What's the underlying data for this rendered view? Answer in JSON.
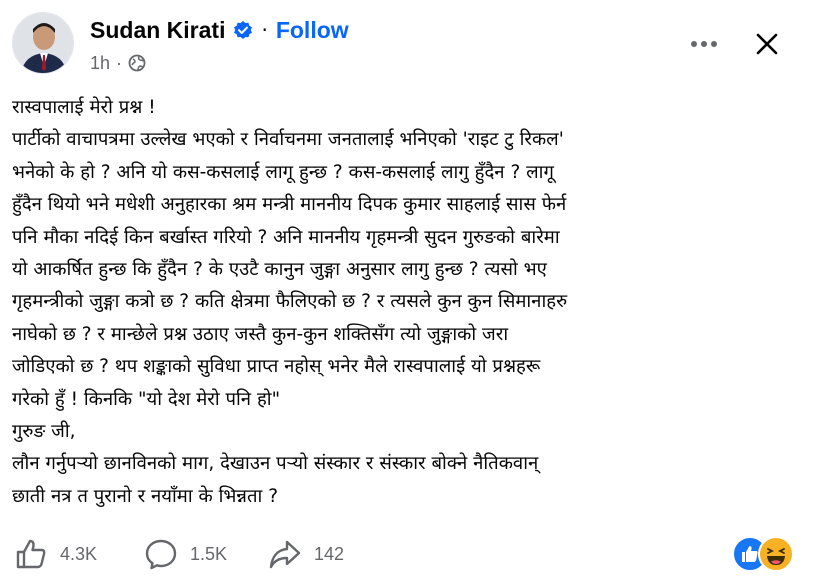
{
  "author": {
    "name": "Sudan Kirati",
    "follow_label": "Follow",
    "separator": "·",
    "time": "1h",
    "meta_separator": "·"
  },
  "icons": {
    "verified": "verified-badge-icon",
    "audience": "globe-icon",
    "more": "more-options-icon",
    "close": "close-icon",
    "like": "like-icon",
    "comment": "comment-icon",
    "share": "share-icon"
  },
  "post": {
    "lines": [
      "रास्वपालाई मेरो प्रश्न !",
      "पार्टीको वाचापत्रमा उल्लेख भएको र निर्वाचनमा जनतालाई भनिएको 'राइट टु रिकल'",
      "भनेको के हो ? अनि यो कस-कसलाई लागू हुन्छ ?  कस-कसलाई लागु हुँदैन ? लागू",
      "हुँदैन थियो भने मधेशी अनुहारका श्रम मन्त्री माननीय दिपक कुमार साहलाई सास फेर्न",
      "पनि मौका नदिई किन बर्खास्त गरियो ? अनि माननीय गृहमन्त्री सुदन गुरुङको बारेमा",
      "यो आकर्षित हुन्छ कि हुँदैन ? के एउटै कानुन जुङ्गा अनुसार लागु हुन्छ ? त्यसो भए",
      "गृहमन्त्रीको जुङ्गा कत्रो छ ? कति क्षेत्रमा फैलिएको छ ? र त्यसले कुन कुन सिमानाहरु",
      "नाघेको छ ? र मान्छेले  प्रश्न उठाए जस्तै कुन-कुन शक्तिसँग त्यो जुङ्गाको जरा",
      "जोडिएको छ ? थप शङ्काको सुविधा प्राप्त नहोस् भनेर मैले रास्वपालाई यो प्रश्नहरू",
      "गरेको हुँ ! किनकि \"यो देश मेरो पनि हो\"",
      "गुरुङ जी,",
      "लौन गर्नुपर्‍यो छानविनको माग, देखाउन पर्‍यो संस्कार र संस्कार बोक्ने नैतिकवान्",
      "छाती नत्र त पुरानो र नयाँमा के भिन्नता ?"
    ]
  },
  "stats": {
    "likes": "4.3K",
    "comments": "1.5K",
    "shares": "142"
  },
  "colors": {
    "accent": "#0866ff",
    "text": "#050505",
    "muted": "#65676b",
    "like_reaction": "#1877f2",
    "haha_reaction": "#f7b125"
  }
}
